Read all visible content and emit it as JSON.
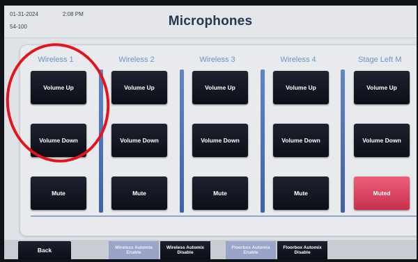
{
  "header": {
    "date": "01-31-2024",
    "time": "2:08 PM",
    "room": "54-100",
    "title": "Microphones"
  },
  "columns": [
    {
      "label": "Wireless 1",
      "volume_up": "Volume Up",
      "volume_down": "Volume Down",
      "mute": "Mute",
      "mute_state": "unmuted"
    },
    {
      "label": "Wireless 2",
      "volume_up": "Volume Up",
      "volume_down": "Volume Down",
      "mute": "Mute",
      "mute_state": "unmuted"
    },
    {
      "label": "Wireless 3",
      "volume_up": "Volume Up",
      "volume_down": "Volume Down",
      "mute": "Mute",
      "mute_state": "unmuted"
    },
    {
      "label": "Wireless 4",
      "volume_up": "Volume Up",
      "volume_down": "Volume Down",
      "mute": "Mute",
      "mute_state": "unmuted"
    },
    {
      "label": "Stage Left M",
      "volume_up": "Volume Up",
      "volume_down": "Volume Down",
      "mute": "Muted",
      "mute_state": "muted"
    }
  ],
  "footer": {
    "back": "Back",
    "wireless_enable": {
      "line1": "Wireless Automix",
      "line2": "Enable"
    },
    "wireless_disable": {
      "line1": "Wireless Automix",
      "line2": "Disable"
    },
    "floorbox_enable": {
      "line1": "Floorbox Automix",
      "line2": "Enable"
    },
    "floorbox_disable": {
      "line1": "Floorbox Automix",
      "line2": "Disable"
    }
  },
  "colors": {
    "accent_blue": "#5f86c6",
    "muted_red": "#dc4560",
    "annotation_red": "#e3141b"
  }
}
